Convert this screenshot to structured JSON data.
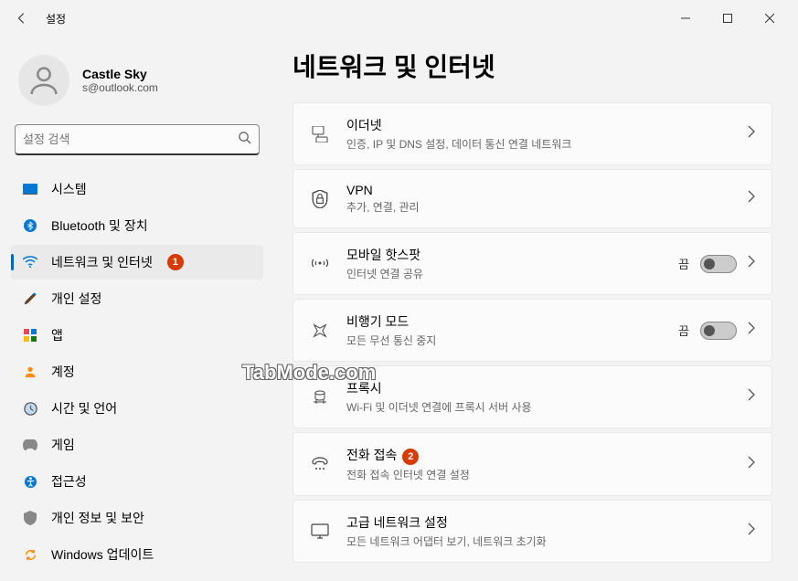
{
  "window": {
    "title": "설정"
  },
  "user": {
    "name": "Castle Sky",
    "email": "s@outlook.com"
  },
  "search": {
    "placeholder": "설정 검색"
  },
  "sidebar": {
    "items": [
      {
        "label": "시스템"
      },
      {
        "label": "Bluetooth 및 장치"
      },
      {
        "label": "네트워크 및 인터넷",
        "badge": "1"
      },
      {
        "label": "개인 설정"
      },
      {
        "label": "앱"
      },
      {
        "label": "계정"
      },
      {
        "label": "시간 및 언어"
      },
      {
        "label": "게임"
      },
      {
        "label": "접근성"
      },
      {
        "label": "개인 정보 및 보안"
      },
      {
        "label": "Windows 업데이트"
      }
    ]
  },
  "page": {
    "title": "네트워크 및 인터넷"
  },
  "cards": [
    {
      "title": "이더넷",
      "sub": "인증, IP 및 DNS 설정, 데이터 통신 연결 네트워크"
    },
    {
      "title": "VPN",
      "sub": "추가, 연결, 관리"
    },
    {
      "title": "모바일 핫스팟",
      "sub": "인터넷 연결 공유",
      "toggle": "끔"
    },
    {
      "title": "비행기 모드",
      "sub": "모든 무선 통신 중지",
      "toggle": "끔"
    },
    {
      "title": "프록시",
      "sub": "Wi-Fi 및 이더넷 연결에 프록시 서버 사용"
    },
    {
      "title": "전화 접속",
      "sub": "전화 접속 인터넷 연결 설정",
      "badge": "2"
    },
    {
      "title": "고급 네트워크 설정",
      "sub": "모든 네트워크 어댑터 보기, 네트워크 초기화"
    }
  ],
  "watermark": "TabMode.com"
}
